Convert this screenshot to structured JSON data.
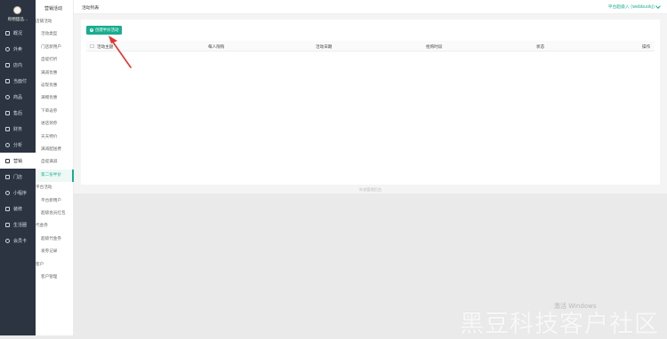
{
  "sidebar": {
    "store_name": "购物甜品...",
    "items": [
      {
        "label": "概况",
        "icon": "overview-icon"
      },
      {
        "label": "外卖",
        "icon": "takeout-icon"
      },
      {
        "label": "店内",
        "icon": "store-icon"
      },
      {
        "label": "当面付",
        "icon": "payment-icon"
      },
      {
        "label": "商品",
        "icon": "goods-icon"
      },
      {
        "label": "售后",
        "icon": "aftersale-icon"
      },
      {
        "label": "财务",
        "icon": "finance-icon"
      },
      {
        "label": "分析",
        "icon": "analysis-icon"
      },
      {
        "label": "营销",
        "icon": "marketing-icon"
      },
      {
        "label": "门店",
        "icon": "shop-icon"
      },
      {
        "label": "小程序",
        "icon": "miniapp-icon"
      },
      {
        "label": "装修",
        "icon": "decor-icon"
      },
      {
        "label": "生活圈",
        "icon": "life-circle-icon"
      },
      {
        "label": "会员卡",
        "icon": "member-card-icon"
      }
    ],
    "active_index": 8
  },
  "subnav": {
    "title": "营销活动",
    "items": [
      {
        "label": "店铺活动",
        "type": "group"
      },
      {
        "label": "活动类型",
        "type": "sub"
      },
      {
        "label": "门店新用户",
        "type": "sub"
      },
      {
        "label": "自提打折",
        "type": "sub"
      },
      {
        "label": "满减优惠",
        "type": "sub"
      },
      {
        "label": "返现优惠",
        "type": "sub"
      },
      {
        "label": "满赠优惠",
        "type": "sub"
      },
      {
        "label": "下单返券",
        "type": "sub"
      },
      {
        "label": "进店领券",
        "type": "sub"
      },
      {
        "label": "天天特价",
        "type": "sub"
      },
      {
        "label": "满减配送费",
        "type": "sub"
      },
      {
        "label": "自提满减",
        "type": "sub"
      },
      {
        "label": "第二份半价",
        "type": "sub"
      },
      {
        "label": "平台活动",
        "type": "group"
      },
      {
        "label": "平台新用户",
        "type": "sub"
      },
      {
        "label": "超级会员红包",
        "type": "sub"
      },
      {
        "label": "代金券",
        "type": "group"
      },
      {
        "label": "超级代金券",
        "type": "sub"
      },
      {
        "label": "发券记录",
        "type": "sub"
      },
      {
        "label": "客户",
        "type": "group"
      },
      {
        "label": "客户管理",
        "type": "sub"
      }
    ],
    "active_index": 12
  },
  "header": {
    "title": "活动列表",
    "user": "平台超级入 (webbuokj)"
  },
  "toolbar": {
    "create_label": "创建半价活动"
  },
  "table": {
    "columns": [
      "活动主题",
      "每人限购",
      "活动日期",
      "抢购时段",
      "状态",
      "操作"
    ]
  },
  "footer": {
    "text": "外卖管理后台"
  },
  "os_watermark": "激活 Windows",
  "watermark": "黑豆科技客户社区",
  "colors": {
    "accent": "#1aad8f",
    "sidebar_bg": "#2b3440",
    "arrow": "#e5322d"
  }
}
